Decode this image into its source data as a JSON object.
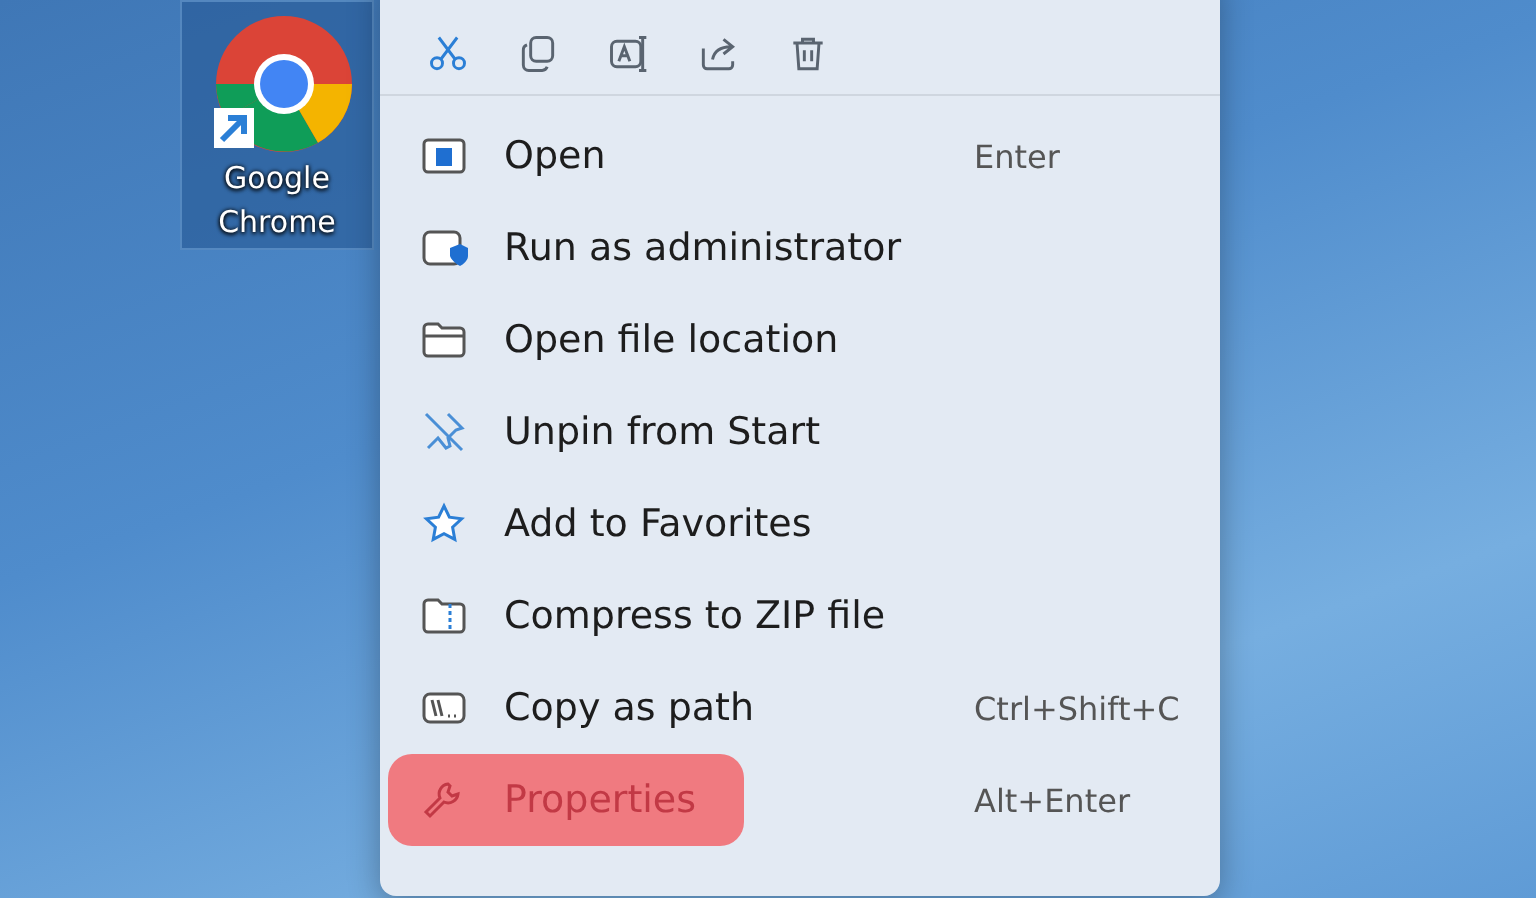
{
  "desktop_icon": {
    "label": "Google Chrome",
    "selected": true
  },
  "context_menu": {
    "toolbar": [
      {
        "kind": "cut"
      },
      {
        "kind": "copy"
      },
      {
        "kind": "rename"
      },
      {
        "kind": "share"
      },
      {
        "kind": "delete"
      }
    ],
    "items": [
      {
        "label": "Open",
        "shortcut": "Enter",
        "highlighted": false
      },
      {
        "label": "Run as administrator",
        "highlighted": false
      },
      {
        "label": "Open file location",
        "highlighted": false
      },
      {
        "label": "Unpin from Start",
        "highlighted": false
      },
      {
        "label": "Add to Favorites",
        "highlighted": false
      },
      {
        "label": "Compress to ZIP file",
        "highlighted": false
      },
      {
        "label": "Copy as path",
        "shortcut": "Ctrl+Shift+C",
        "highlighted": false
      },
      {
        "label": "Properties",
        "shortcut": "Alt+Enter",
        "highlighted": true
      }
    ]
  }
}
